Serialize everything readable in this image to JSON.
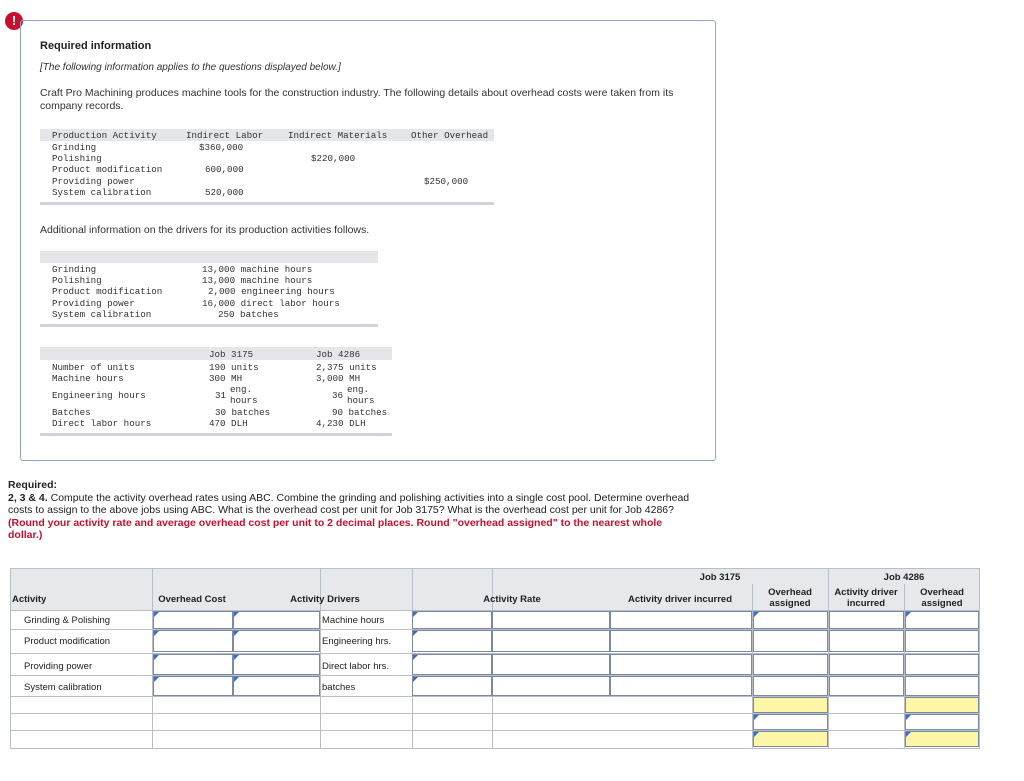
{
  "alert_icon": "!",
  "info": {
    "heading": "Required information",
    "note": "[The following information applies to the questions displayed below.]",
    "intro": "Craft Pro Machining produces machine tools for the construction industry. The following details about overhead costs were taken from its company records."
  },
  "cost_table": {
    "headers": [
      "Production Activity",
      "Indirect Labor",
      "Indirect Materials",
      "Other Overhead"
    ],
    "rows": [
      {
        "activity": "Grinding",
        "labor": "$360,000",
        "materials": "",
        "other": ""
      },
      {
        "activity": "Polishing",
        "labor": "",
        "materials": "$220,000",
        "other": ""
      },
      {
        "activity": "Product modification",
        "labor": "600,000",
        "materials": "",
        "other": ""
      },
      {
        "activity": "Providing power",
        "labor": "",
        "materials": "",
        "other": "$250,000"
      },
      {
        "activity": "System calibration",
        "labor": "520,000",
        "materials": "",
        "other": ""
      }
    ]
  },
  "additional_text": "Additional information on the drivers for its production activities follows.",
  "driver_table": {
    "rows": [
      {
        "activity": "Grinding",
        "driver": "13,000 machine hours"
      },
      {
        "activity": "Polishing",
        "driver": "13,000 machine hours"
      },
      {
        "activity": "Product modification",
        "driver": "2,000 engineering hours"
      },
      {
        "activity": "Providing power",
        "driver": "16,000 direct labor hours"
      },
      {
        "activity": "System calibration",
        "driver": "250 batches"
      }
    ]
  },
  "job_table": {
    "headers": [
      "Job 3175",
      "Job 4286"
    ],
    "labels": [
      "Number of units",
      "Machine hours",
      "Engineering hours",
      "Batches",
      "Direct labor hours"
    ],
    "job3175": {
      "units": "190 units",
      "mh": "300 MH",
      "eng_num": "31",
      "eng_unit1": "eng.",
      "eng_unit2": "hours",
      "batches": "30 batches",
      "dlh": "470 DLH"
    },
    "job4286": {
      "units": "2,375 units",
      "mh": "3,000 MH",
      "eng_num": "36",
      "eng_unit1": "eng.",
      "eng_unit2": "hours",
      "batches": "90 batches",
      "dlh": "4,230 DLH"
    }
  },
  "required": {
    "label": "Required:",
    "text": "2, 3 & 4. Compute the activity overhead rates using ABC. Combine the grinding and polishing activities into a single cost pool. Determine overhead costs to assign to the above jobs using ABC. What is the overhead cost per unit for Job 3175? What is the overhead cost per unit for Job 4286?",
    "emphasis": "(Round your activity rate and average overhead cost per unit to 2 decimal places. Round \"overhead assigned\" to the nearest whole dollar.)",
    "bold_prefix": "2, 3 & 4."
  },
  "answer_grid": {
    "job_a": "Job 3175",
    "job_b": "Job 4286",
    "col_activity": "Activity",
    "col_overhead_cost": "Overhead Cost",
    "col_activity_drivers": "Activity Drivers",
    "col_activity_rate": "Activity Rate",
    "col_driver_incurred_a": "Activity driver incurred",
    "col_overhead_assigned_a": "Overhead assigned",
    "col_driver_incurred_b": "Activity driver incurred",
    "col_overhead_assigned_b": "Overhead assigned",
    "rows": [
      {
        "activity": "Grinding & Polishing",
        "driver": "Machine hours"
      },
      {
        "activity": "Product modification",
        "driver": "Engineering hrs."
      },
      {
        "activity": "Providing power",
        "driver": "Direct labor hrs."
      },
      {
        "activity": "System calibration",
        "driver": "batches"
      }
    ]
  }
}
